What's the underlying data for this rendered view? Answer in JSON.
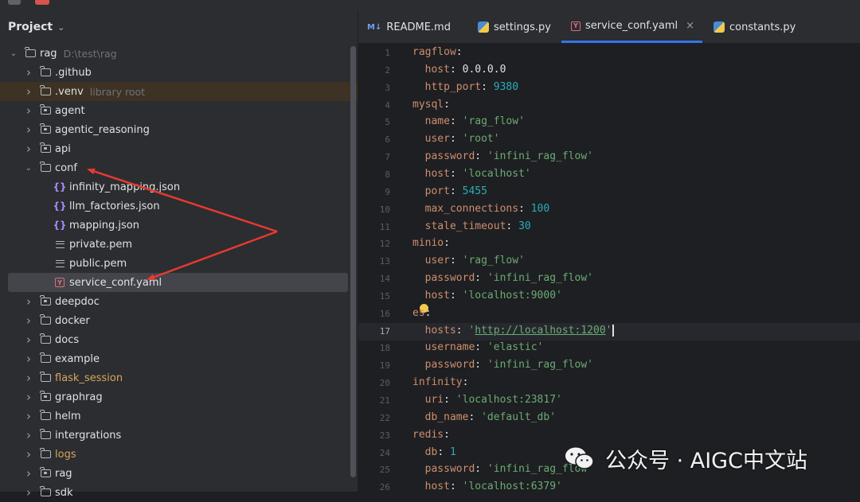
{
  "project_panel": {
    "title": "Project",
    "tree": [
      {
        "label": "rag",
        "hint": "D:\\test\\rag",
        "depth": 0,
        "type": "folder",
        "expanded": true
      },
      {
        "label": ".github",
        "depth": 1,
        "type": "folder"
      },
      {
        "label": ".venv",
        "hint": "library root",
        "depth": 1,
        "type": "folder"
      },
      {
        "label": "agent",
        "depth": 1,
        "type": "package"
      },
      {
        "label": "agentic_reasoning",
        "depth": 1,
        "type": "package"
      },
      {
        "label": "api",
        "depth": 1,
        "type": "package"
      },
      {
        "label": "conf",
        "depth": 1,
        "type": "folder",
        "expanded": true
      },
      {
        "label": "infinity_mapping.json",
        "depth": 2,
        "type": "json"
      },
      {
        "label": "llm_factories.json",
        "depth": 2,
        "type": "json"
      },
      {
        "label": "mapping.json",
        "depth": 2,
        "type": "json"
      },
      {
        "label": "private.pem",
        "depth": 2,
        "type": "pem"
      },
      {
        "label": "public.pem",
        "depth": 2,
        "type": "pem"
      },
      {
        "label": "service_conf.yaml",
        "depth": 2,
        "type": "yaml",
        "selected": true
      },
      {
        "label": "deepdoc",
        "depth": 1,
        "type": "package"
      },
      {
        "label": "docker",
        "depth": 1,
        "type": "folder"
      },
      {
        "label": "docs",
        "depth": 1,
        "type": "folder"
      },
      {
        "label": "example",
        "depth": 1,
        "type": "folder"
      },
      {
        "label": "flask_session",
        "depth": 1,
        "type": "folder",
        "excluded": true
      },
      {
        "label": "graphrag",
        "depth": 1,
        "type": "package"
      },
      {
        "label": "helm",
        "depth": 1,
        "type": "folder"
      },
      {
        "label": "intergrations",
        "depth": 1,
        "type": "folder"
      },
      {
        "label": "logs",
        "depth": 1,
        "type": "folder",
        "excluded": true
      },
      {
        "label": "rag",
        "depth": 1,
        "type": "package"
      },
      {
        "label": "sdk",
        "depth": 1,
        "type": "folder"
      }
    ]
  },
  "tabs": [
    {
      "label": "README.md",
      "icon": "markdown-icon"
    },
    {
      "label": "settings.py",
      "icon": "python-icon"
    },
    {
      "label": "service_conf.yaml",
      "icon": "yaml-icon",
      "active": true,
      "close": "×"
    },
    {
      "label": "constants.py",
      "icon": "python-icon"
    }
  ],
  "editor": {
    "current_line": 17,
    "lines": [
      {
        "n": "1",
        "tokens": [
          [
            "k",
            "ragflow"
          ],
          [
            "p",
            ":"
          ]
        ]
      },
      {
        "n": "2",
        "tokens": [
          [
            "p",
            "  "
          ],
          [
            "k",
            "host"
          ],
          [
            "p",
            ": "
          ],
          [
            "p",
            "0.0.0.0"
          ]
        ]
      },
      {
        "n": "3",
        "tokens": [
          [
            "p",
            "  "
          ],
          [
            "k",
            "http_port"
          ],
          [
            "p",
            ": "
          ],
          [
            "n",
            "9380"
          ]
        ]
      },
      {
        "n": "4",
        "tokens": [
          [
            "k",
            "mysql"
          ],
          [
            "p",
            ":"
          ]
        ]
      },
      {
        "n": "5",
        "tokens": [
          [
            "p",
            "  "
          ],
          [
            "k",
            "name"
          ],
          [
            "p",
            ": "
          ],
          [
            "s",
            "'rag_flow'"
          ]
        ]
      },
      {
        "n": "6",
        "tokens": [
          [
            "p",
            "  "
          ],
          [
            "k",
            "user"
          ],
          [
            "p",
            ": "
          ],
          [
            "s",
            "'root'"
          ]
        ]
      },
      {
        "n": "7",
        "tokens": [
          [
            "p",
            "  "
          ],
          [
            "k",
            "password"
          ],
          [
            "p",
            ": "
          ],
          [
            "s",
            "'infini_rag_flow'"
          ]
        ]
      },
      {
        "n": "8",
        "tokens": [
          [
            "p",
            "  "
          ],
          [
            "k",
            "host"
          ],
          [
            "p",
            ": "
          ],
          [
            "s",
            "'localhost'"
          ]
        ]
      },
      {
        "n": "9",
        "tokens": [
          [
            "p",
            "  "
          ],
          [
            "k",
            "port"
          ],
          [
            "p",
            ": "
          ],
          [
            "n",
            "5455"
          ]
        ]
      },
      {
        "n": "10",
        "tokens": [
          [
            "p",
            "  "
          ],
          [
            "k",
            "max_connections"
          ],
          [
            "p",
            ": "
          ],
          [
            "n",
            "100"
          ]
        ]
      },
      {
        "n": "11",
        "tokens": [
          [
            "p",
            "  "
          ],
          [
            "k",
            "stale_timeout"
          ],
          [
            "p",
            ": "
          ],
          [
            "n",
            "30"
          ]
        ]
      },
      {
        "n": "12",
        "tokens": [
          [
            "k",
            "minio"
          ],
          [
            "p",
            ":"
          ]
        ]
      },
      {
        "n": "13",
        "tokens": [
          [
            "p",
            "  "
          ],
          [
            "k",
            "user"
          ],
          [
            "p",
            ": "
          ],
          [
            "s",
            "'rag_flow'"
          ]
        ]
      },
      {
        "n": "14",
        "tokens": [
          [
            "p",
            "  "
          ],
          [
            "k",
            "password"
          ],
          [
            "p",
            ": "
          ],
          [
            "s",
            "'infini_rag_flow'"
          ]
        ]
      },
      {
        "n": "15",
        "tokens": [
          [
            "p",
            "  "
          ],
          [
            "k",
            "host"
          ],
          [
            "p",
            ": "
          ],
          [
            "s",
            "'localhost:9000'"
          ]
        ]
      },
      {
        "n": "16",
        "tokens": [
          [
            "k",
            "es"
          ],
          [
            "p",
            ":"
          ]
        ]
      },
      {
        "n": "17",
        "tokens": [
          [
            "p",
            "  "
          ],
          [
            "k",
            "hosts"
          ],
          [
            "p",
            ": "
          ],
          [
            "s",
            "'"
          ],
          [
            "url",
            "http://localhost:1200"
          ],
          [
            "s",
            "'"
          ]
        ]
      },
      {
        "n": "18",
        "tokens": [
          [
            "p",
            "  "
          ],
          [
            "k",
            "username"
          ],
          [
            "p",
            ": "
          ],
          [
            "s",
            "'elastic'"
          ]
        ]
      },
      {
        "n": "19",
        "tokens": [
          [
            "p",
            "  "
          ],
          [
            "k",
            "password"
          ],
          [
            "p",
            ": "
          ],
          [
            "s",
            "'infini_rag_flow'"
          ]
        ]
      },
      {
        "n": "20",
        "tokens": [
          [
            "k",
            "infinity"
          ],
          [
            "p",
            ":"
          ]
        ]
      },
      {
        "n": "21",
        "tokens": [
          [
            "p",
            "  "
          ],
          [
            "k",
            "uri"
          ],
          [
            "p",
            ": "
          ],
          [
            "s",
            "'localhost:23817'"
          ]
        ]
      },
      {
        "n": "22",
        "tokens": [
          [
            "p",
            "  "
          ],
          [
            "k",
            "db_name"
          ],
          [
            "p",
            ": "
          ],
          [
            "s",
            "'default_db'"
          ]
        ]
      },
      {
        "n": "23",
        "tokens": [
          [
            "k",
            "redis"
          ],
          [
            "p",
            ":"
          ]
        ]
      },
      {
        "n": "24",
        "tokens": [
          [
            "p",
            "  "
          ],
          [
            "k",
            "db"
          ],
          [
            "p",
            ": "
          ],
          [
            "n",
            "1"
          ]
        ]
      },
      {
        "n": "25",
        "tokens": [
          [
            "p",
            "  "
          ],
          [
            "k",
            "password"
          ],
          [
            "p",
            ": "
          ],
          [
            "s",
            "'infini_rag_flow'"
          ]
        ]
      },
      {
        "n": "26",
        "tokens": [
          [
            "p",
            "  "
          ],
          [
            "k",
            "host"
          ],
          [
            "p",
            ": "
          ],
          [
            "s",
            "'localhost:6379'"
          ]
        ]
      }
    ]
  },
  "watermark": {
    "text": "公众号 · AIGC中文站"
  },
  "colors": {
    "annotation_arrow": "#e8392f",
    "accent": "#3574f0"
  }
}
